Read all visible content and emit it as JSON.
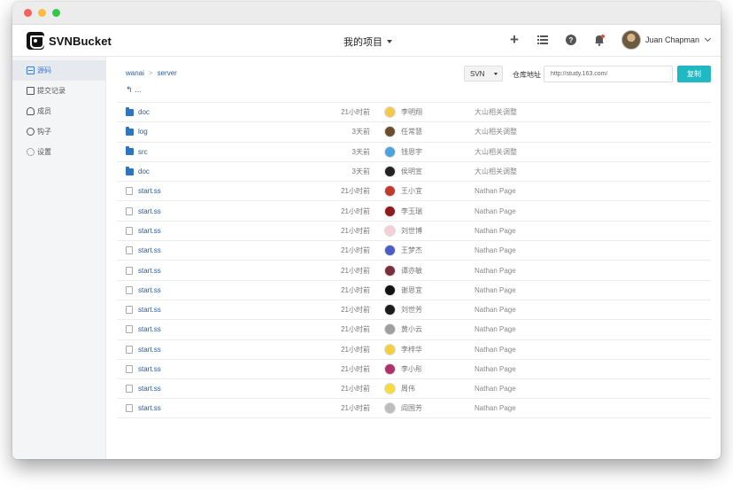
{
  "window": {
    "colors": {
      "accent": "#1fb8c3",
      "link": "#2a5d9f",
      "folder": "#2f74c0"
    }
  },
  "header": {
    "logo_text": "SVNBucket",
    "project_menu": "我的项目",
    "user_name": "Juan Chapman",
    "icons": [
      "plus-icon",
      "list-icon",
      "help-icon",
      "bell-icon"
    ]
  },
  "sidebar": {
    "items": [
      {
        "label": "源码",
        "icon": "code-icon",
        "active": true
      },
      {
        "label": "提交记录",
        "icon": "commit-icon",
        "active": false
      },
      {
        "label": "成员",
        "icon": "members-icon",
        "active": false
      },
      {
        "label": "钩子",
        "icon": "hook-icon",
        "active": false
      },
      {
        "label": "设置",
        "icon": "settings-icon",
        "active": false
      }
    ]
  },
  "main": {
    "breadcrumb": [
      "wanai",
      "server"
    ],
    "back_label": "...",
    "repo_type": "SVN",
    "repo_label": "仓库地址",
    "repo_url": "http://study.163.com/",
    "copy_label": "复制",
    "files": [
      {
        "type": "folder",
        "name": "doc",
        "time": "21小时前",
        "author": "李明翔",
        "avatar": "#f2c94c",
        "message": "大山相关调整"
      },
      {
        "type": "folder",
        "name": "log",
        "time": "3天前",
        "author": "任常慧",
        "avatar": "#6b4e2e",
        "message": "大山相关调整"
      },
      {
        "type": "folder",
        "name": "src",
        "time": "3天前",
        "author": "钱恩宇",
        "avatar": "#4aa3df",
        "message": "大山相关调整"
      },
      {
        "type": "folder",
        "name": "doc",
        "time": "3天前",
        "author": "侯明宣",
        "avatar": "#222222",
        "message": "大山相关调整"
      },
      {
        "type": "file",
        "name": "start.ss",
        "time": "21小时前",
        "author": "王小宜",
        "avatar": "#c0392b",
        "message": "Nathan Page"
      },
      {
        "type": "file",
        "name": "start.ss",
        "time": "21小时前",
        "author": "李玉瑞",
        "avatar": "#8e1b1b",
        "message": "Nathan Page"
      },
      {
        "type": "file",
        "name": "start.ss",
        "time": "21小时前",
        "author": "刘世博",
        "avatar": "#f5d0d8",
        "message": "Nathan Page"
      },
      {
        "type": "file",
        "name": "start.ss",
        "time": "21小时前",
        "author": "王梦杰",
        "avatar": "#4b5cc4",
        "message": "Nathan Page"
      },
      {
        "type": "file",
        "name": "start.ss",
        "time": "21小时前",
        "author": "谭亦敏",
        "avatar": "#7a2f3b",
        "message": "Nathan Page"
      },
      {
        "type": "file",
        "name": "start.ss",
        "time": "21小时前",
        "author": "谢恩宜",
        "avatar": "#111111",
        "message": "Nathan Page"
      },
      {
        "type": "file",
        "name": "start.ss",
        "time": "21小时前",
        "author": "刘世芳",
        "avatar": "#1a1a1a",
        "message": "Nathan Page"
      },
      {
        "type": "file",
        "name": "start.ss",
        "time": "21小时前",
        "author": "黄小云",
        "avatar": "#9e9e9e",
        "message": "Nathan Page"
      },
      {
        "type": "file",
        "name": "start.ss",
        "time": "21小时前",
        "author": "李梓华",
        "avatar": "#f4d03f",
        "message": "Nathan Page"
      },
      {
        "type": "file",
        "name": "start.ss",
        "time": "21小时前",
        "author": "李小彤",
        "avatar": "#b0306a",
        "message": "Nathan Page"
      },
      {
        "type": "file",
        "name": "start.ss",
        "time": "21小时前",
        "author": "周伟",
        "avatar": "#f7dc3a",
        "message": "Nathan Page"
      },
      {
        "type": "file",
        "name": "start.ss",
        "time": "21小时前",
        "author": "阎国芳",
        "avatar": "#bdbdbd",
        "message": "Nathan Page"
      }
    ]
  }
}
